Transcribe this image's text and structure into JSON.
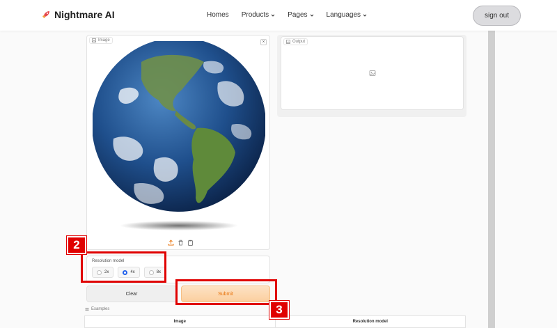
{
  "header": {
    "brand": "Nightmare AI",
    "nav": [
      "Homes",
      "Products",
      "Pages",
      "Languages"
    ],
    "signout_label": "sign out"
  },
  "input_panel": {
    "label": "Image"
  },
  "output_panel": {
    "label": "Output"
  },
  "resolution": {
    "label": "Resolution model",
    "options": [
      "2x",
      "4x",
      "8x"
    ],
    "selected": "4x"
  },
  "buttons": {
    "clear": "Clear",
    "submit": "Submit"
  },
  "examples": {
    "label": "Examples",
    "columns": [
      "Image",
      "Resolution model"
    ]
  },
  "annotations": {
    "step2": "2",
    "step3": "3"
  },
  "colors": {
    "accent": "#e8730c",
    "annotation": "#e00000",
    "radio": "#2563eb"
  },
  "icons": [
    "rocket-icon",
    "chevron-down-icon",
    "image-icon",
    "close-icon",
    "upload-icon",
    "trash-icon",
    "clipboard-icon",
    "radio-icon"
  ]
}
